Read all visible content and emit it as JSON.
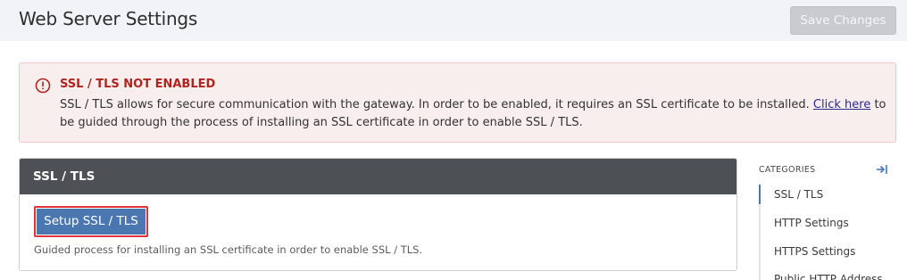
{
  "header": {
    "title": "Web Server Settings",
    "save_label": "Save Changes"
  },
  "alert": {
    "title": "SSL / TLS NOT ENABLED",
    "body_before": "SSL / TLS allows for secure communication with the gateway. In order to be enabled, it requires an SSL certificate to be installed. ",
    "link": "Click here",
    "body_after": " to be guided through the process of installing an SSL certificate in order to enable SSL / TLS."
  },
  "panel": {
    "title": "SSL / TLS",
    "button_label": "Setup SSL / TLS",
    "description": "Guided process for installing an SSL certificate in order to enable SSL / TLS."
  },
  "categories": {
    "title": "CATEGORIES",
    "items": [
      {
        "label": "SSL / TLS",
        "active": true
      },
      {
        "label": "HTTP Settings",
        "active": false
      },
      {
        "label": "HTTPS Settings",
        "active": false
      },
      {
        "label": "Public HTTP Address",
        "active": false
      }
    ]
  },
  "colors": {
    "accent": "#4b77b1",
    "alert_red": "#b0241f",
    "panel_header": "#4d5055"
  }
}
